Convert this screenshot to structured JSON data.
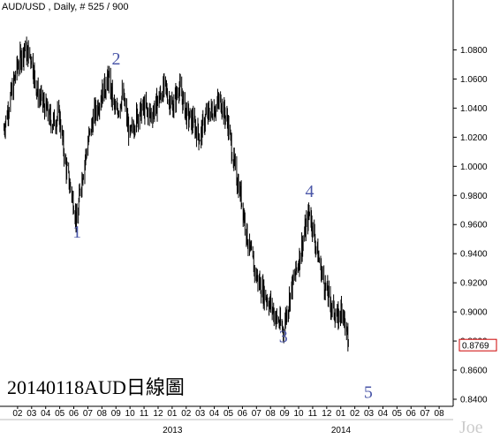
{
  "header": {
    "title": "AUD/USD , Daily, # 525 / 900"
  },
  "annotation": "20140118AUD日線圖",
  "watermark": "Joe",
  "colors": {
    "price": "#000000",
    "wave_label": "#4a56a8",
    "last_price_box": "#cc0000",
    "axis": "#000000",
    "background": "#ffffff"
  },
  "chart_data": {
    "type": "line",
    "style": "ohlc-bars",
    "title": "AUD/USD , Daily, # 525 / 900",
    "xlabel": "",
    "ylabel": "",
    "ylim": [
      0.84,
      1.09
    ],
    "xlim": [
      "2012-01-01",
      "2014-09-01"
    ],
    "grid": false,
    "legend": "none",
    "y_ticks": [
      "1.0800",
      "1.0600",
      "1.0400",
      "1.0200",
      "1.0000",
      "0.9800",
      "0.9600",
      "0.9400",
      "0.9200",
      "0.9000",
      "0.8800",
      "0.8600",
      "0.8400"
    ],
    "x_ticks": [
      "02",
      "03",
      "04",
      "05",
      "06",
      "07",
      "08",
      "09",
      "10",
      "11",
      "12",
      "01",
      "02",
      "03",
      "04",
      "05",
      "06",
      "07",
      "08",
      "09",
      "10",
      "11",
      "12",
      "01",
      "02",
      "03",
      "04",
      "05",
      "06",
      "07",
      "08"
    ],
    "year_labels": [
      {
        "label": "2013",
        "date": "2013-01-01"
      },
      {
        "label": "2014",
        "date": "2014-01-01"
      }
    ],
    "last_price": "0.8769",
    "series": [
      {
        "points": [
          [
            "2012-01-01",
            1.025
          ],
          [
            "2012-01-18",
            1.05
          ],
          [
            "2012-02-01",
            1.07
          ],
          [
            "2012-02-15",
            1.08
          ],
          [
            "2012-03-01",
            1.075
          ],
          [
            "2012-03-15",
            1.05
          ],
          [
            "2012-04-01",
            1.04
          ],
          [
            "2012-04-15",
            1.03
          ],
          [
            "2012-05-01",
            1.035
          ],
          [
            "2012-05-15",
            1.0
          ],
          [
            "2012-06-01",
            0.975
          ],
          [
            "2012-06-08",
            0.96
          ],
          [
            "2012-06-15",
            0.985
          ],
          [
            "2012-07-01",
            1.015
          ],
          [
            "2012-07-15",
            1.035
          ],
          [
            "2012-08-01",
            1.05
          ],
          [
            "2012-08-15",
            1.06
          ],
          [
            "2012-09-01",
            1.035
          ],
          [
            "2012-09-15",
            1.05
          ],
          [
            "2012-10-01",
            1.02
          ],
          [
            "2012-10-15",
            1.035
          ],
          [
            "2012-11-01",
            1.04
          ],
          [
            "2012-11-15",
            1.035
          ],
          [
            "2012-12-01",
            1.045
          ],
          [
            "2012-12-15",
            1.055
          ],
          [
            "2013-01-01",
            1.04
          ],
          [
            "2013-01-15",
            1.055
          ],
          [
            "2013-02-01",
            1.035
          ],
          [
            "2013-02-15",
            1.03
          ],
          [
            "2013-03-01",
            1.02
          ],
          [
            "2013-03-15",
            1.035
          ],
          [
            "2013-04-01",
            1.04
          ],
          [
            "2013-04-15",
            1.045
          ],
          [
            "2013-05-01",
            1.03
          ],
          [
            "2013-05-15",
            1.0
          ],
          [
            "2013-06-01",
            0.975
          ],
          [
            "2013-06-15",
            0.945
          ],
          [
            "2013-07-01",
            0.925
          ],
          [
            "2013-07-15",
            0.915
          ],
          [
            "2013-08-01",
            0.905
          ],
          [
            "2013-08-15",
            0.895
          ],
          [
            "2013-08-29",
            0.888
          ],
          [
            "2013-09-15",
            0.915
          ],
          [
            "2013-10-01",
            0.935
          ],
          [
            "2013-10-15",
            0.955
          ],
          [
            "2013-10-25",
            0.97
          ],
          [
            "2013-11-08",
            0.945
          ],
          [
            "2013-11-25",
            0.92
          ],
          [
            "2013-12-10",
            0.905
          ],
          [
            "2013-12-25",
            0.895
          ],
          [
            "2014-01-05",
            0.905
          ],
          [
            "2014-01-10",
            0.89
          ],
          [
            "2014-01-18",
            0.877
          ]
        ]
      }
    ],
    "annotations": [
      {
        "text": "1",
        "x": "2012-06-08",
        "y": 0.951
      },
      {
        "text": "2",
        "x": "2012-09-01",
        "y": 1.07
      },
      {
        "text": "3",
        "x": "2013-08-29",
        "y": 0.879
      },
      {
        "text": "4",
        "x": "2013-10-25",
        "y": 0.979
      },
      {
        "text": "5",
        "x": "2014-03-01",
        "y": 0.841
      }
    ]
  }
}
